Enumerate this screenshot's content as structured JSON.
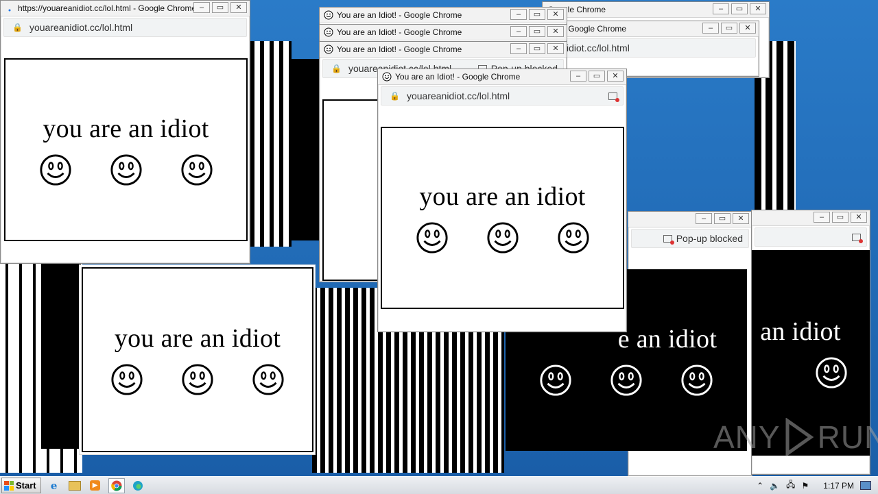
{
  "windows": {
    "w1": {
      "title": "https://youareanidiot.cc/lol.html - Google Chrome",
      "url": "youareanidiot.cc/lol.html",
      "message": "you are an idiot"
    },
    "w2": {
      "title": "You are an Idiot! - Google Chrome"
    },
    "w3": {
      "title": "You are an Idiot! - Google Chrome"
    },
    "w4": {
      "title": "You are an Idiot! - Google Chrome"
    },
    "w5": {
      "url": "youareanidiot.cc/lol.html",
      "popup": "Pop-up blocked"
    },
    "w6": {
      "title": "You are an Idiot! - Google Chrome",
      "url": "youareanidiot.cc/lol.html",
      "message": "you are an idiot"
    },
    "w7": {
      "message": "you are an idiot"
    },
    "w8": {
      "message": "an idiot"
    },
    "w9": {
      "message": "e an idiot",
      "popup": "Pop-up blocked"
    },
    "w10": {
      "title": "- Google Chrome",
      "url": "idiot.cc/lol.html"
    },
    "w11": {
      "title": "You are an Idiot! - Google Chrome"
    }
  },
  "taskbar": {
    "start_label": "Start",
    "clock": "1:17 PM"
  },
  "watermark": {
    "left": "ANY",
    "right": "RUN"
  },
  "colors": {
    "desktop": "#1f6cb5",
    "window_bg": "#ffffff",
    "content_dark": "#000000"
  }
}
